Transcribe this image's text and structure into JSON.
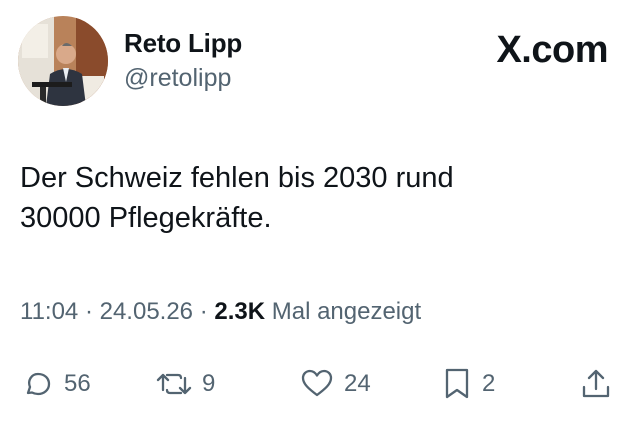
{
  "author": {
    "name": "Reto Lipp",
    "handle": "@retolipp"
  },
  "brand": "X.com",
  "tweet": {
    "text": "Der Schweiz fehlen bis 2030 rund\n30000 Pflegekräfte."
  },
  "meta": {
    "time": "11:04",
    "sep1": " · ",
    "date": "24.05.26",
    "sep2": " · ",
    "views": "2.3K",
    "views_label": " Mal angezeigt"
  },
  "actions": {
    "replies": "56",
    "reposts": "9",
    "likes": "24",
    "bookmarks": "2"
  },
  "icons": {
    "reply": "reply-icon",
    "repost": "repost-icon",
    "like": "like-icon",
    "bookmark": "bookmark-icon",
    "share": "share-icon"
  },
  "colors": {
    "text": "#0f1419",
    "secondary": "#536471",
    "background": "#ffffff"
  }
}
